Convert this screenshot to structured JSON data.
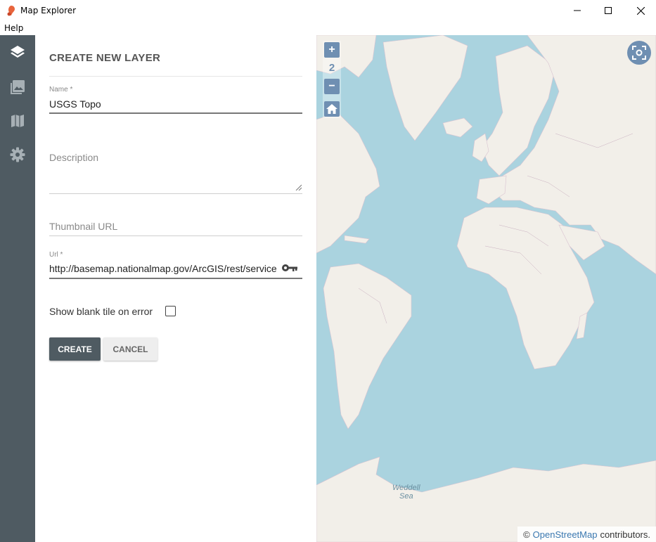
{
  "window": {
    "title": "Map Explorer",
    "icon": "app-logo-icon"
  },
  "menu": {
    "items": [
      "Help"
    ]
  },
  "sidebar": {
    "items": [
      {
        "icon": "layers-icon",
        "active": true
      },
      {
        "icon": "image-icon",
        "active": false
      },
      {
        "icon": "map-icon",
        "active": false
      },
      {
        "icon": "gear-icon",
        "active": false
      }
    ]
  },
  "form": {
    "title": "CREATE NEW LAYER",
    "name": {
      "label": "Name *",
      "value": "USGS Topo"
    },
    "description": {
      "placeholder": "Description",
      "value": ""
    },
    "thumbnail": {
      "placeholder": "Thumbnail URL",
      "value": ""
    },
    "url": {
      "label": "Url *",
      "value": "http://basemap.nationalmap.gov/ArcGIS/rest/services/USGSTopo/MapServer/tile/{z}/{y}/{x}"
    },
    "blank_tile": {
      "label": "Show blank tile on error",
      "checked": false
    },
    "create_label": "CREATE",
    "cancel_label": "CANCEL"
  },
  "map": {
    "zoom_in": "+",
    "zoom_level": "2",
    "zoom_out": "−",
    "labels": [
      {
        "text": "Weddell\nSea"
      }
    ],
    "attribution": {
      "prefix": "©",
      "link": "OpenStreetMap",
      "suffix": "contributors."
    }
  },
  "colors": {
    "sidebar": "#4f5b62",
    "accent": "#6f8fb2",
    "water": "#aad3df",
    "land": "#f2efe9"
  }
}
